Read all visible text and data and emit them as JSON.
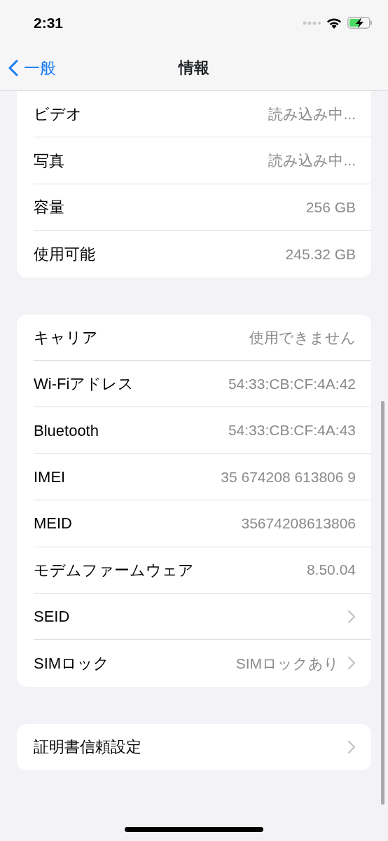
{
  "status_bar": {
    "time": "2:31"
  },
  "nav": {
    "back_label": "一般",
    "title": "情報"
  },
  "groups": [
    {
      "rows": [
        {
          "label": "ビデオ",
          "value": "読み込み中..."
        },
        {
          "label": "写真",
          "value": "読み込み中..."
        },
        {
          "label": "容量",
          "value": "256 GB"
        },
        {
          "label": "使用可能",
          "value": "245.32 GB"
        }
      ]
    },
    {
      "rows": [
        {
          "label": "キャリア",
          "value": "使用できません"
        },
        {
          "label": "Wi-Fiアドレス",
          "value": "54:33:CB:CF:4A:42"
        },
        {
          "label": "Bluetooth",
          "value": "54:33:CB:CF:4A:43"
        },
        {
          "label": "IMEI",
          "value": "35 674208 613806 9"
        },
        {
          "label": "MEID",
          "value": "35674208613806"
        },
        {
          "label": "モデムファームウェア",
          "value": "8.50.04"
        },
        {
          "label": "SEID",
          "chevron": true
        },
        {
          "label": "SIMロック",
          "value": "SIMロックあり",
          "chevron": true
        }
      ]
    },
    {
      "rows": [
        {
          "label": "証明書信頼設定",
          "chevron": true
        }
      ]
    }
  ]
}
